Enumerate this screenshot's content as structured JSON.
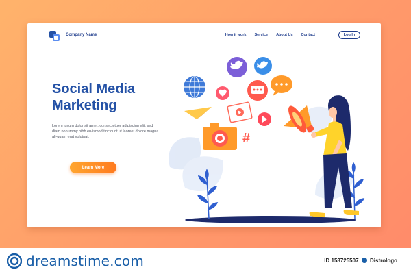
{
  "nav": {
    "brand": "Company Name",
    "menu": [
      "How it work",
      "Service",
      "About Us",
      "Contact"
    ],
    "login_label": "Log In"
  },
  "hero": {
    "title_line1": "Social Media",
    "title_line2": "Marketing",
    "body": "Lorem ipsum dolor sit amet, consectetuer adipiscing elit, sed diam nonummy nibh eu-ismod tincidunt ut laoreet dolore magna ali-quam erat volutpat.",
    "cta_label": "Learn More"
  },
  "illustration": {
    "icons": [
      "globe-icon",
      "twitter-bird-icon",
      "twitter-icon",
      "heart-icon",
      "chat-icon",
      "speech-bubble-icon",
      "paper-plane-icon",
      "video-icon",
      "camera-icon",
      "hashtag-icon",
      "megaphone-icon"
    ]
  },
  "watermark": {
    "site": "dreamstime.com",
    "id_text": "ID 153725507",
    "author": "Distrologo"
  },
  "colors": {
    "accent": "#2552a6",
    "cta": "#ff8a24",
    "background": "#ff9a6a"
  }
}
